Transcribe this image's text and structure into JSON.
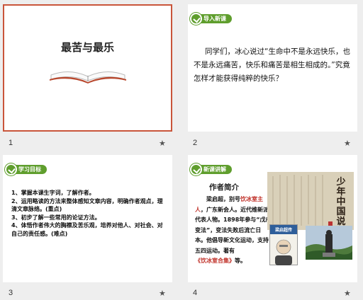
{
  "slides": [
    {
      "number": "1",
      "title": "最苦与最乐"
    },
    {
      "number": "2",
      "badge": "导入新课",
      "text": "同学们，冰心说过“生命中不是永远快乐，也不是永远痛苦，快乐和痛苦是相生相成的。”究竟怎样才能获得纯粹的快乐？"
    },
    {
      "number": "3",
      "badge": "学习目标",
      "items": [
        "1、掌握本课生字词，了解作者。",
        "2、运用略读的方法来整体感知文章内容，明确作者观点，理清文章脉络。(重点)",
        "3、初步了解一些常用的论证方法。",
        "4、体悟作者伟大的胸襟及苦乐观，培养对他人、对社会、对自己的责任感。(难点)"
      ]
    },
    {
      "number": "4",
      "badge": "新课讲解",
      "heading": "作者简介",
      "bio_parts": [
        "梁启超，别号",
        "饮冰室主人",
        "，广东新会人。近代维新派代表人物。1898年参与“戊戌变法”，变法失败后流亡日本。他倡导新文化运动，支持五四运动。著有",
        "《饮冰室合集》",
        "等。"
      ],
      "calligraphy": "少年中国说",
      "book_title": "梁启超传",
      "accent_red": "#c0322a"
    }
  ],
  "star_icon": "star-icon",
  "colors": {
    "badge_green": "#5f9e2d",
    "selection_border": "#c9553a"
  }
}
